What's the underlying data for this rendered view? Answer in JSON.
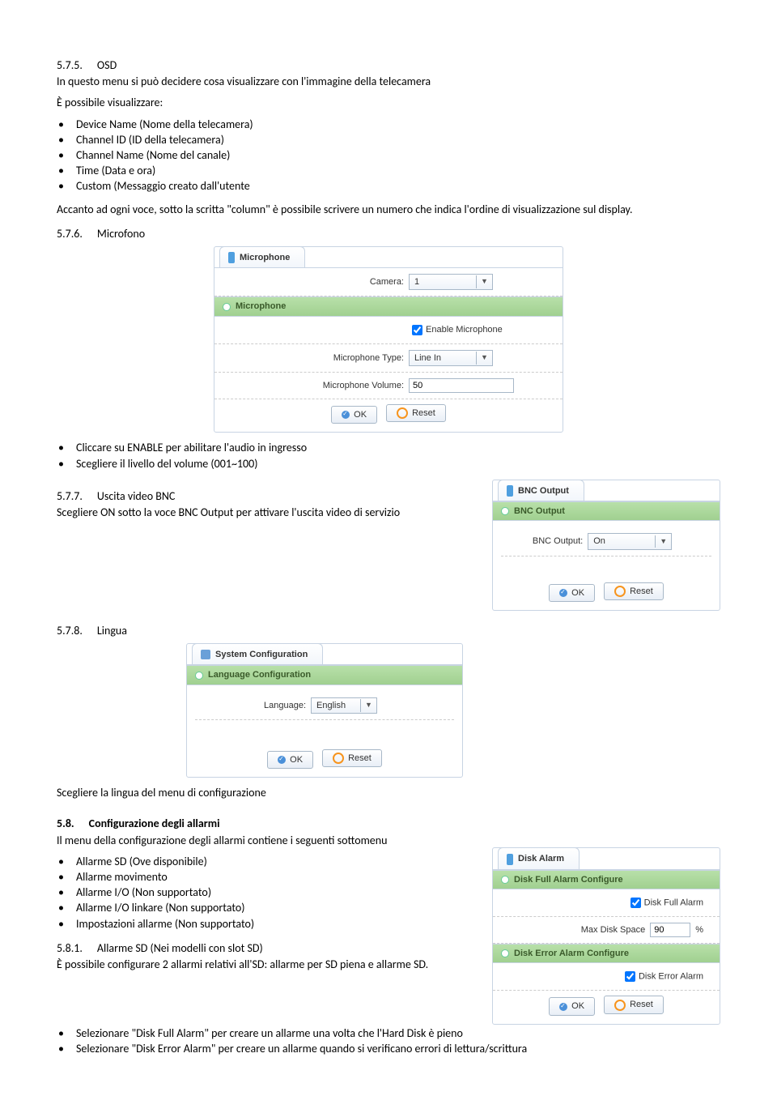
{
  "s575": {
    "no": "5.7.5.",
    "title": "OSD",
    "p1": "In questo menu si può decidere cosa visualizzare con l'immagine della telecamera",
    "p2": "È possibile visualizzare:",
    "items": [
      "Device Name (Nome della telecamera)",
      "Channel ID (ID della telecamera)",
      "Channel Name (Nome del canale)",
      "Time (Data e ora)",
      "Custom (Messaggio creato dall'utente"
    ],
    "p3": "Accanto ad ogni voce, sotto la scritta \"column\" è possibile scrivere un numero che indica l'ordine di visualizzazione sul display."
  },
  "s576": {
    "no": "5.7.6.",
    "title": "Microfono"
  },
  "mic_panel": {
    "tab": "Microphone",
    "sub": "Microphone",
    "camera_label": "Camera:",
    "camera_value": "1",
    "enable_label": "Enable Microphone",
    "type_label": "Microphone Type:",
    "type_value": "Line In",
    "volume_label": "Microphone Volume:",
    "volume_value": "50"
  },
  "buttons": {
    "ok": "OK",
    "reset": "Reset"
  },
  "s576_items": [
    "Cliccare su ENABLE per abilitare l'audio in ingresso",
    "Scegliere il livello del volume (001~100)"
  ],
  "s577": {
    "no": "5.7.7.",
    "title": "Uscita video BNC",
    "p": "Scegliere ON sotto la voce BNC Output per attivare l'uscita video di servizio"
  },
  "bnc_panel": {
    "tab": "BNC Output",
    "sub": "BNC Output",
    "label": "BNC Output:",
    "value": "On"
  },
  "s578": {
    "no": "5.7.8.",
    "title": "Lingua"
  },
  "sys_panel": {
    "tab": "System Configuration",
    "sub": "Language Configuration",
    "label": "Language:",
    "value": "English"
  },
  "s578_p": "Scegliere la lingua del menu di configurazione",
  "s58": {
    "no": "5.8.",
    "title": "Configurazione degli allarmi",
    "p": "Il menu della configurazione degli allarmi contiene i seguenti sottomenu",
    "items": [
      "Allarme SD (Ove disponibile)",
      "Allarme movimento",
      "Allarme I/O (Non supportato)",
      "Allarme I/O linkare (Non supportato)",
      "Impostazioni allarme (Non supportato)"
    ]
  },
  "disk_panel": {
    "tab": "Disk Alarm",
    "sub1": "Disk Full Alarm Configure",
    "full_label": "Disk Full Alarm",
    "space_label": "Max Disk Space",
    "space_value": "90",
    "space_unit": "%",
    "sub2": "Disk Error Alarm Configure",
    "error_label": "Disk Error Alarm"
  },
  "s581": {
    "no": "5.8.1.",
    "title": "Allarme SD (Nei modelli con slot SD)",
    "p": "È possibile configurare 2 allarmi relativi all'SD: allarme per SD piena e allarme SD.",
    "items": [
      "Selezionare \"Disk Full Alarm\" per creare un allarme una volta che l'Hard Disk è pieno",
      "Selezionare \"Disk Error Alarm\" per creare un allarme quando si verificano errori di lettura/scrittura"
    ]
  }
}
